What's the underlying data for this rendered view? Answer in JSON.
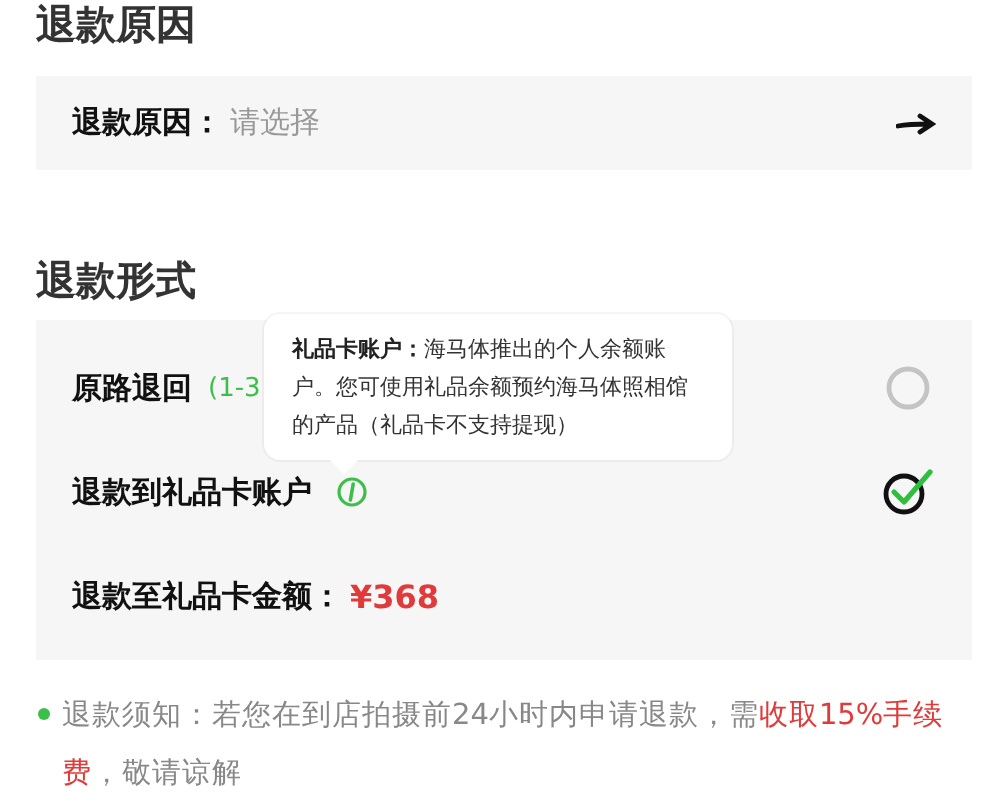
{
  "reason_section": {
    "title": "退款原因",
    "field": {
      "label": "退款原因：",
      "placeholder": "请选择"
    }
  },
  "method_section": {
    "title": "退款形式",
    "options": [
      {
        "label": "原路退回",
        "note": "(1-3",
        "selected": false,
        "info": false
      },
      {
        "label": "退款到礼品卡账户",
        "selected": true,
        "info": true
      }
    ],
    "amount": {
      "label": "退款至礼品卡金额：",
      "value": "¥368"
    },
    "tooltip": {
      "term": "礼品卡账户：",
      "text": "海马体推出的个人余额账户。您可使用礼品余额预约海马体照相馆的产品（礼品卡不支持提现）"
    }
  },
  "notice": [
    {
      "kind": "plain",
      "text": "退款须知：若您在到店拍摄前24小时内申请退款，需"
    },
    {
      "kind": "warning",
      "text": "收取15%手续费"
    },
    {
      "kind": "plain",
      "text": "，敬请谅解"
    }
  ]
}
